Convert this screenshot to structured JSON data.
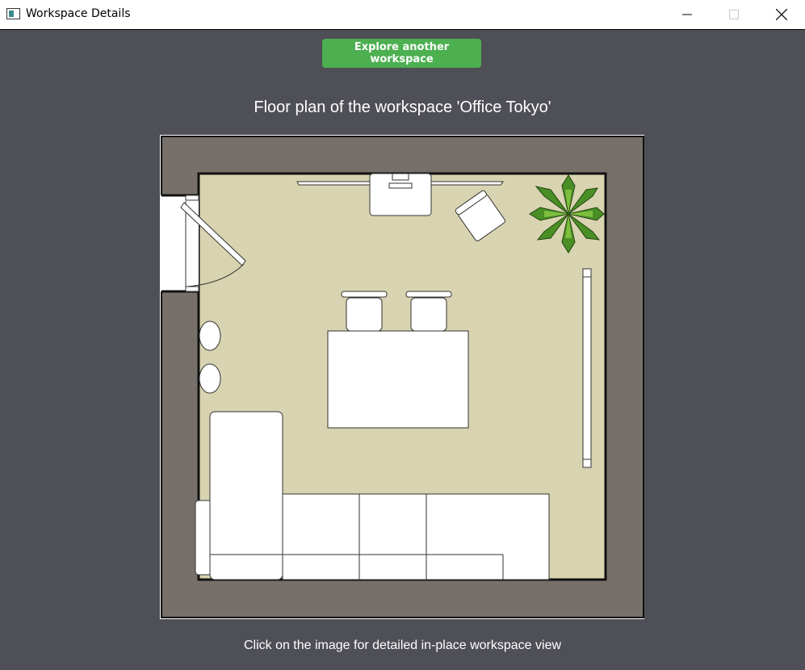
{
  "window": {
    "title": "Workspace Details",
    "icon": "app-window-icon",
    "controls": [
      "minimize-icon",
      "maximize-icon",
      "close-icon"
    ]
  },
  "actions": {
    "explore_label": "Explore another workspace"
  },
  "floorplan": {
    "title": "Floor plan of the workspace 'Office Tokyo'",
    "caption": "Click on the image for detailed in-place workspace view",
    "colors": {
      "wall": "#77706a",
      "floor": "#d8d3b0",
      "furniture": "#ffffff",
      "plant": "#4a8f25"
    }
  },
  "colors": {
    "background": "#4f4f58",
    "accent": "#4caf50"
  }
}
